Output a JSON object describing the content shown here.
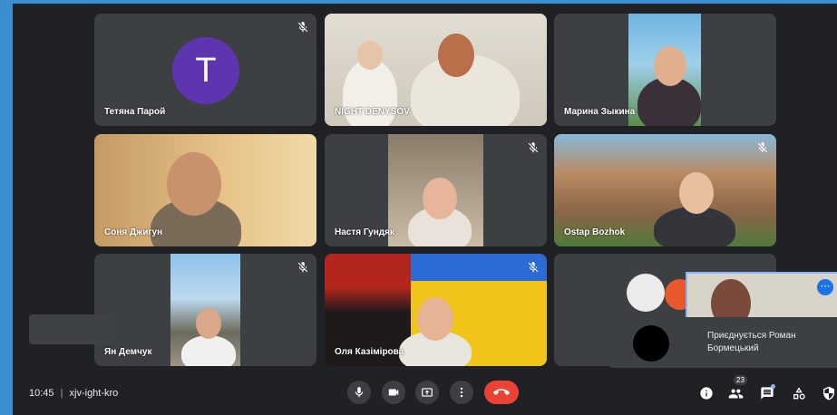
{
  "meeting": {
    "time": "10:45",
    "separator": "|",
    "code": "xjv-ight-kro"
  },
  "participants_count": "23",
  "tiles": [
    {
      "name": "Тетяна Парой",
      "avatar_letter": "T",
      "muted": true
    },
    {
      "name": "NIGHT DENYSOV",
      "muted": false
    },
    {
      "name": "Марина Зыкина",
      "muted": false
    },
    {
      "name": "Соня Джигун",
      "muted": false
    },
    {
      "name": "Настя Гундяк",
      "muted": true
    },
    {
      "name": "Ostap Bozhok",
      "muted": true
    },
    {
      "name": "Ян Демчук",
      "muted": true
    },
    {
      "name": "Оля Казімірова",
      "muted": true
    },
    {
      "name": "",
      "muted": false
    }
  ],
  "toast": {
    "text": "Приєднується Роман Бормецький"
  },
  "colors": {
    "background": "#202124",
    "tile": "#3c4043",
    "avatar": "#5e35b1",
    "end_call": "#ea4335",
    "self_view_border": "#8ab4f8"
  },
  "icons": [
    "mic-icon",
    "camera-icon",
    "present-icon",
    "more-icon",
    "end-call-icon",
    "info-icon",
    "people-icon",
    "chat-icon",
    "activities-icon",
    "host-controls-icon"
  ]
}
